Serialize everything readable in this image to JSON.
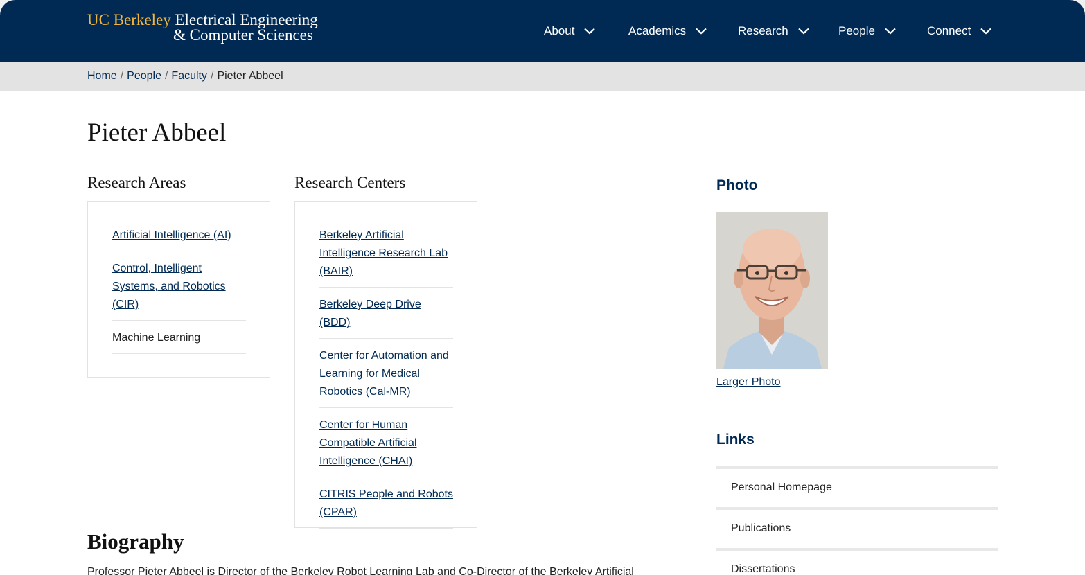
{
  "header": {
    "logo_uc": "UC Berkeley",
    "logo_line1": "Electrical Engineering",
    "logo_line2": "& Computer Sciences",
    "nav": [
      "About",
      "Academics",
      "Research",
      "People",
      "Connect"
    ]
  },
  "breadcrumb": {
    "items": [
      "Home",
      "People",
      "Faculty"
    ],
    "current": "Pieter Abbeel"
  },
  "page_title": "Pieter Abbeel",
  "research_areas": {
    "heading": "Research Areas",
    "items": [
      {
        "label": "Artificial Intelligence (AI)",
        "link": true
      },
      {
        "label": "Control, Intelligent Systems, and Robotics (CIR)",
        "link": true
      },
      {
        "label": "Machine Learning",
        "link": false
      }
    ]
  },
  "research_centers": {
    "heading": "Research Centers",
    "items": [
      "Berkeley Artificial Intelligence Research Lab (BAIR)",
      "Berkeley Deep Drive (BDD)",
      "Center for Automation and Learning for Medical Robotics (Cal-MR)",
      "Center for Human Compatible Artificial Intelligence (CHAI)",
      "CITRIS People and Robots (CPAR)"
    ]
  },
  "sidebar": {
    "photo_heading": "Photo",
    "larger_photo": "Larger Photo",
    "links_heading": "Links",
    "links": [
      "Personal Homepage",
      "Publications",
      "Dissertations"
    ]
  },
  "biography": {
    "heading": "Biography",
    "text": "Professor Pieter Abbeel is Director of the Berkeley Robot Learning Lab and Co-Director of the Berkeley Artificial"
  },
  "colors": {
    "navy": "#002a54",
    "gold": "#f2b53d",
    "breadcrumb_bg": "#e3e3e3"
  }
}
